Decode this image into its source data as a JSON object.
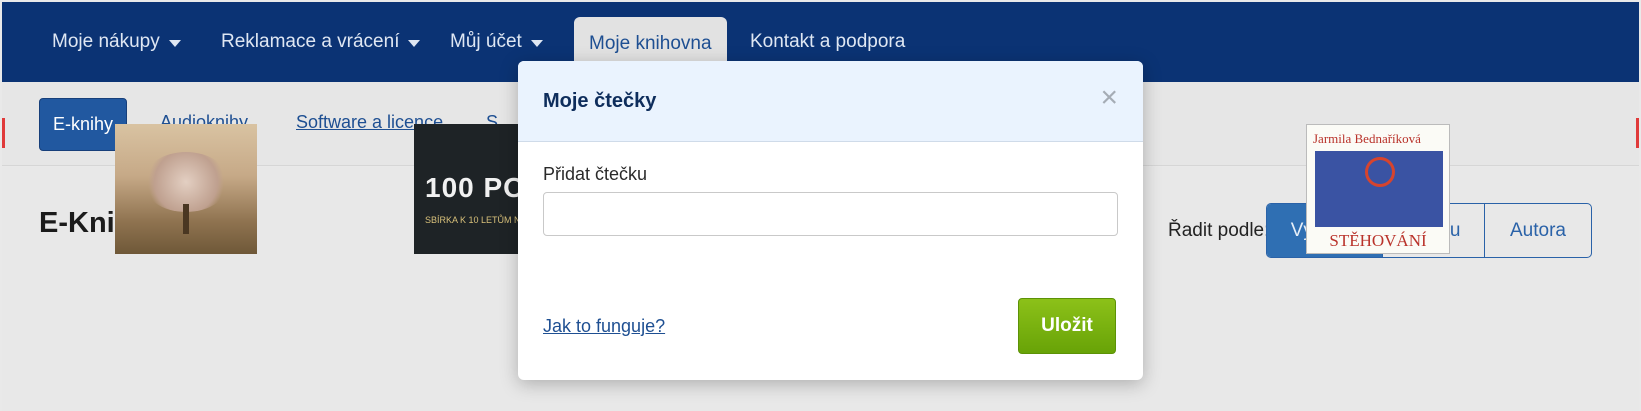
{
  "topnav": {
    "items": [
      {
        "label": "Moje nákupy",
        "has_dropdown": true
      },
      {
        "label": "Reklamace a vrácení",
        "has_dropdown": true
      },
      {
        "label": "Můj účet",
        "has_dropdown": true
      },
      {
        "label": "Moje knihovna",
        "active": true
      },
      {
        "label": "Kontakt a podpora"
      }
    ]
  },
  "subnav": {
    "active": "E-knihy",
    "links": [
      "Audioknihy",
      "Software a licence",
      "S"
    ]
  },
  "content": {
    "title": "E-Knihy",
    "sort_label": "Řadit podle:",
    "sort_options": [
      "Výchozí",
      "Názvu",
      "Autora"
    ],
    "sort_selected": "Výchozí",
    "books": [
      {
        "cover_text": ""
      },
      {
        "cover_text": "100 POVÍD",
        "cover_subtext": "SBÍRKA K 10 LETŮM NAKLADATELSTVÍ E-KNIHY JEDOU"
      },
      {
        "cover_text": ""
      },
      {
        "cover_text": ""
      },
      {
        "author": "Jarmila Bednaříková",
        "cover_text": "STĚHOVÁNÍ"
      }
    ]
  },
  "modal": {
    "title": "Moje čtečky",
    "close_symbol": "×",
    "field_label": "Přidat čtečku",
    "field_value": "",
    "field_placeholder": "",
    "help_link": "Jak to funguje?",
    "save_label": "Uložit"
  },
  "colors": {
    "nav_bg": "#0b3374",
    "accent_blue": "#2158a0",
    "save_green": "#76b10e",
    "modal_header_bg": "#eaf3fe"
  }
}
